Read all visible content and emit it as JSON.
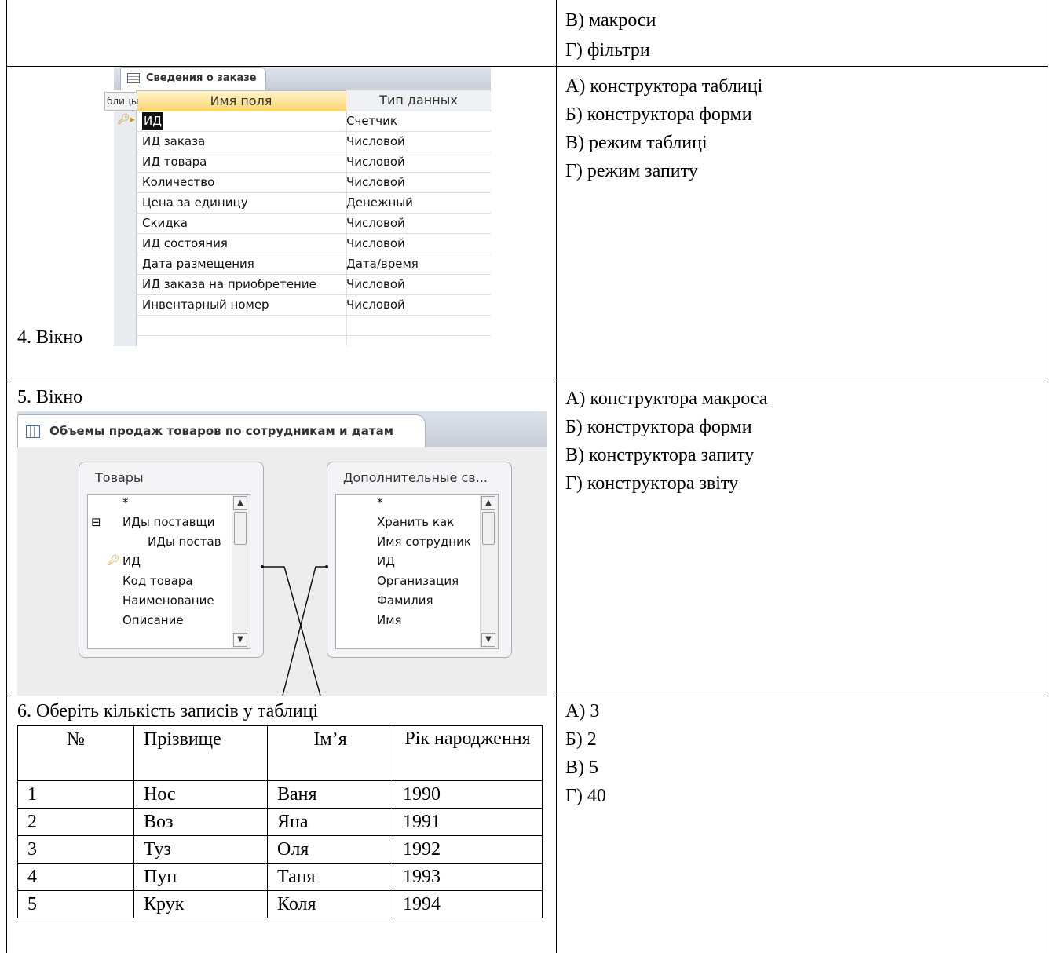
{
  "rows": {
    "row1": {
      "answers": [
        "В) макроси",
        "Г) фільтри"
      ]
    },
    "row2": {
      "question_label": "4. Вікно",
      "answers": [
        "А) конструктора таблиці",
        "Б) конструктора форми",
        "В) режим таблиці",
        "Г) режим запиту"
      ],
      "design_view": {
        "tab_title": "Сведения о заказе",
        "tooltip": "блицы",
        "col_field": "Имя поля",
        "col_type": "Тип данных",
        "fields": [
          {
            "name": "ИД",
            "type": "Счетчик"
          },
          {
            "name": "ИД заказа",
            "type": "Числовой"
          },
          {
            "name": "ИД товара",
            "type": "Числовой"
          },
          {
            "name": "Количество",
            "type": "Числовой"
          },
          {
            "name": "Цена за единицу",
            "type": "Денежный"
          },
          {
            "name": "Скидка",
            "type": "Числовой"
          },
          {
            "name": "ИД состояния",
            "type": "Числовой"
          },
          {
            "name": "Дата размещения",
            "type": "Дата/время"
          },
          {
            "name": "ИД заказа на приобретение",
            "type": "Числовой"
          },
          {
            "name": "Инвентарный номер",
            "type": "Числовой"
          }
        ]
      }
    },
    "row3": {
      "question_label": "5. Вікно",
      "answers": [
        "А) конструктора макроса",
        "Б) конструктора форми",
        "В) конструктора запиту",
        "Г) конструктора звіту"
      ],
      "query_view": {
        "tab_title": "Объемы продаж товаров по сотрудникам и датам",
        "left_table": {
          "name": "Товары",
          "fields": [
            "*",
            "ИДы поставщи",
            "ИДы постав",
            "ИД",
            "Код товара",
            "Наименование",
            "Описание"
          ]
        },
        "right_table": {
          "name": "Дополнительные св...",
          "fields": [
            "*",
            "Хранить как",
            "Имя сотрудник",
            "ИД",
            "Организация",
            "Фамилия",
            "Имя"
          ]
        },
        "expand_symbol": "⊟"
      }
    },
    "row4": {
      "question": "6. Оберіть кількість записів у таблиці",
      "answers": [
        "А) 3",
        "Б) 2",
        "В) 5",
        "Г) 40"
      ],
      "table": {
        "headers": [
          "№",
          "Прізвище",
          "Ім’я",
          "Рік народження"
        ],
        "rows": [
          [
            "1",
            "Нос",
            "Ваня",
            "1990"
          ],
          [
            "2",
            "Воз",
            "Яна",
            "1991"
          ],
          [
            "3",
            "Туз",
            "Оля",
            "1992"
          ],
          [
            "4",
            "Пуп",
            "Таня",
            "1993"
          ],
          [
            "5",
            "Крук",
            "Коля",
            "1994"
          ]
        ]
      }
    }
  }
}
